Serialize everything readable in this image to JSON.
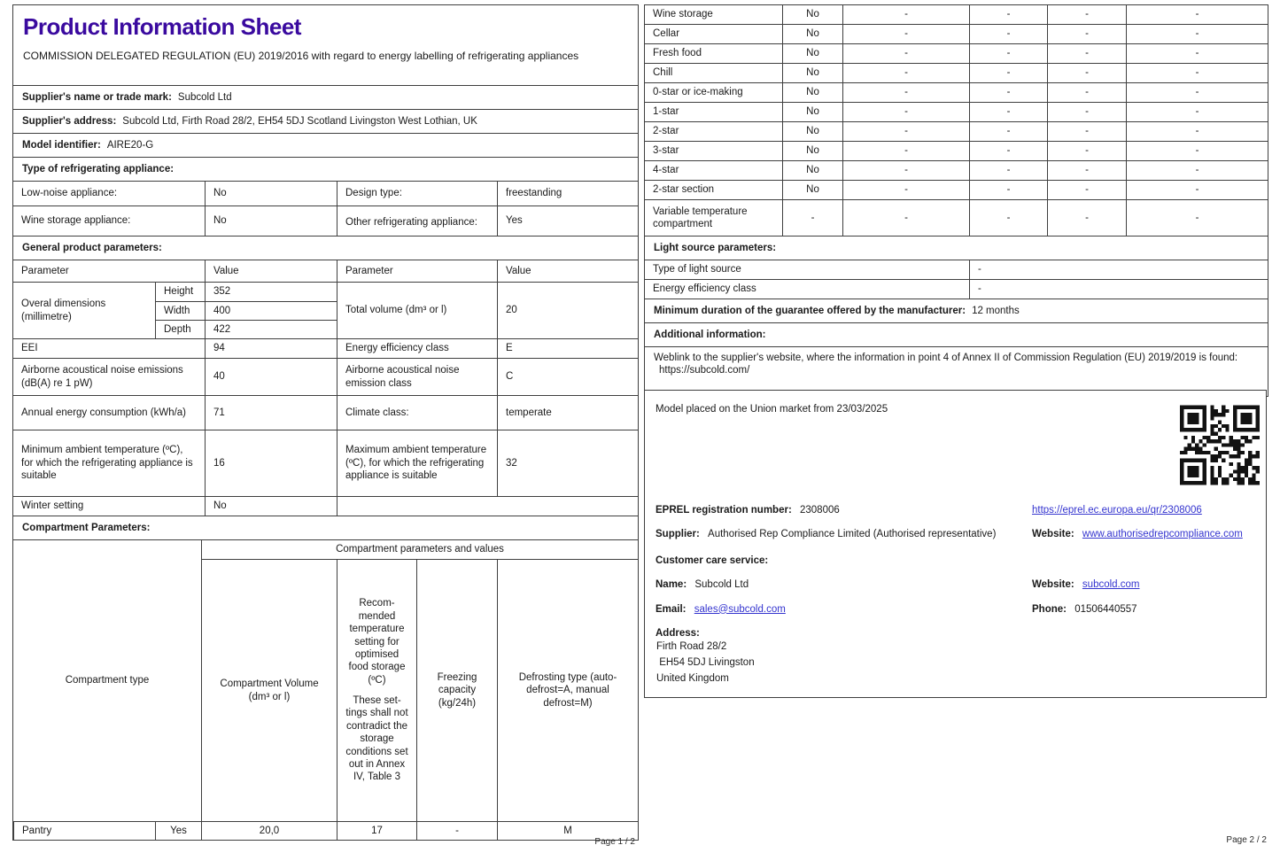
{
  "page1": {
    "title": "Product Information Sheet",
    "subtitle": "COMMISSION DELEGATED REGULATION (EU) 2019/2016 with regard to energy labelling of refrigerating appliances",
    "supplier_name": {
      "label": "Supplier's name or trade mark:",
      "value": "Subcold Ltd"
    },
    "supplier_address": {
      "label": "Supplier's address:",
      "value": "Subcold Ltd, Firth Road 28/2, EH54 5DJ Scotland Livingston West Lothian, UK"
    },
    "model_identifier": {
      "label": "Model identifier:",
      "value": "AIRE20-G"
    },
    "type_section_label": "Type of refrigerating appliance:",
    "low_noise": {
      "label": "Low-noise appliance:",
      "value": "No"
    },
    "design_type": {
      "label": "Design type:",
      "value": "freestanding"
    },
    "wine_storage": {
      "label": "Wine storage appliance:",
      "value": "No"
    },
    "other_appliance": {
      "label": "Other refrigerating appli­ance:",
      "value": "Yes"
    },
    "general_section_label": "General product parameters:",
    "table_headers": {
      "param1": "Parameter",
      "value1": "Value",
      "param2": "Parameter",
      "value2": "Value"
    },
    "dimensions": {
      "label": "Overal dimensions (millimetre)",
      "height_label": "Height",
      "height": "352",
      "width_label": "Width",
      "width": "400",
      "depth_label": "Depth",
      "depth": "422"
    },
    "total_volume": {
      "label": "Total volume (dm³ or l)",
      "value": "20"
    },
    "eei": {
      "label": "EEI",
      "value": "94"
    },
    "energy_class": {
      "label": "Energy efficiency class",
      "value": "E"
    },
    "noise": {
      "label": "Airborne acoustical noise emis­sions (dB(A) re 1 pW)",
      "value": "40"
    },
    "noise_class": {
      "label": "Airborne acoustical noise emission class",
      "value": "C"
    },
    "energy_consumption": {
      "label": "Annual energy consumption (kWh/a)",
      "value": "71"
    },
    "climate_class": {
      "label": "Climate class:",
      "value": "temperate"
    },
    "min_ambient": {
      "label": "Minimum ambient tempera­ture (ºC), for which the refrig­erating appliance is suitable",
      "value": "16"
    },
    "max_ambient": {
      "label": "Maximum ambient tem­perature (ºC), for which the refrigerating appliance is suitable",
      "value": "32"
    },
    "winter_setting": {
      "label": "Winter setting",
      "value": "No"
    },
    "compartment_section_label": "Compartment Parameters:",
    "compartment_table": {
      "group_header": "Compartment parameters and values",
      "type_header": "Compartment type",
      "volume_header": "Compartment Vol­ume (dm³ or l)",
      "temp_header_line1": "Recom­mended tempera­ture setting for opti­mised food storage (ºC)",
      "temp_header_line2": "These set­tings shall not con­tradict the storage conditions set out in Annex IV, Table 3",
      "freezing_header": "Freezing capacity (kg/24h)",
      "defrost_header": "Defrosting type (auto-defrost=A, manual defrost=M)",
      "row": {
        "type": "Pantry",
        "present": "Yes",
        "volume": "20,0",
        "temperature": "17",
        "freezing": "-",
        "defrost": "M"
      }
    },
    "page_number": "Page 1 / 2"
  },
  "page2": {
    "compartment_rows": [
      {
        "label": "Wine storage",
        "value": "No",
        "d1": "-",
        "d2": "-",
        "d3": "-",
        "d4": "-"
      },
      {
        "label": "Cellar",
        "value": "No",
        "d1": "-",
        "d2": "-",
        "d3": "-",
        "d4": "-"
      },
      {
        "label": "Fresh food",
        "value": "No",
        "d1": "-",
        "d2": "-",
        "d3": "-",
        "d4": "-"
      },
      {
        "label": "Chill",
        "value": "No",
        "d1": "-",
        "d2": "-",
        "d3": "-",
        "d4": "-"
      },
      {
        "label": "0-star or ice-making",
        "value": "No",
        "d1": "-",
        "d2": "-",
        "d3": "-",
        "d4": "-"
      },
      {
        "label": "1-star",
        "value": "No",
        "d1": "-",
        "d2": "-",
        "d3": "-",
        "d4": "-"
      },
      {
        "label": "2-star",
        "value": "No",
        "d1": "-",
        "d2": "-",
        "d3": "-",
        "d4": "-"
      },
      {
        "label": "3-star",
        "value": "No",
        "d1": "-",
        "d2": "-",
        "d3": "-",
        "d4": "-"
      },
      {
        "label": "4-star",
        "value": "No",
        "d1": "-",
        "d2": "-",
        "d3": "-",
        "d4": "-"
      },
      {
        "label": "2-star section",
        "value": "No",
        "d1": "-",
        "d2": "-",
        "d3": "-",
        "d4": "-"
      },
      {
        "label": "Variable temperature compartment",
        "value": "-",
        "d1": "-",
        "d2": "-",
        "d3": "-",
        "d4": "-"
      }
    ],
    "light_source_section_label": "Light source parameters:",
    "light_source_type": {
      "label": "Type of light source",
      "value": "-"
    },
    "light_source_class": {
      "label": "Energy efficiency class",
      "value": "-"
    },
    "guarantee": {
      "label": "Minimum duration of the guarantee offered by the manufacturer:",
      "value": "12 months"
    },
    "additional_info_label": "Additional information:",
    "weblink": {
      "label": "Weblink to the supplier's website, where the information in point 4 of Annex II of Commission Regulation (EU) 2019/2019 is found:",
      "value": "https://subcold.com/"
    },
    "market_info": "Model placed on the Union market from 23/03/2025",
    "eprel": {
      "label": "EPREL registration number:",
      "value": "2308006",
      "link": "https://eprel.ec.europa.eu/qr/2308006"
    },
    "supplier": {
      "label": "Supplier:",
      "value": "Authorised Rep Compliance Limited (Authorised representative)",
      "website_label": "Website:",
      "website": "www.authorisedrepcompliance.com"
    },
    "customer_care_label": "Customer care service:",
    "care_name": {
      "label": "Name:",
      "value": "Subcold Ltd"
    },
    "care_website": {
      "label": "Website:",
      "value": "subcold.com"
    },
    "care_email": {
      "label": "Email:",
      "value": "sales@subcold.com"
    },
    "care_phone": {
      "label": "Phone:",
      "value": "01506440557"
    },
    "address_label": "Address:",
    "address_lines": [
      "Firth Road 28/2",
      " EH54 5DJ Livingston",
      "United Kingdom"
    ],
    "page_number": "Page 2 / 2"
  },
  "colors": {
    "title": "#3a0a9f",
    "link": "#3434cf",
    "border": "#3f3f3f"
  }
}
